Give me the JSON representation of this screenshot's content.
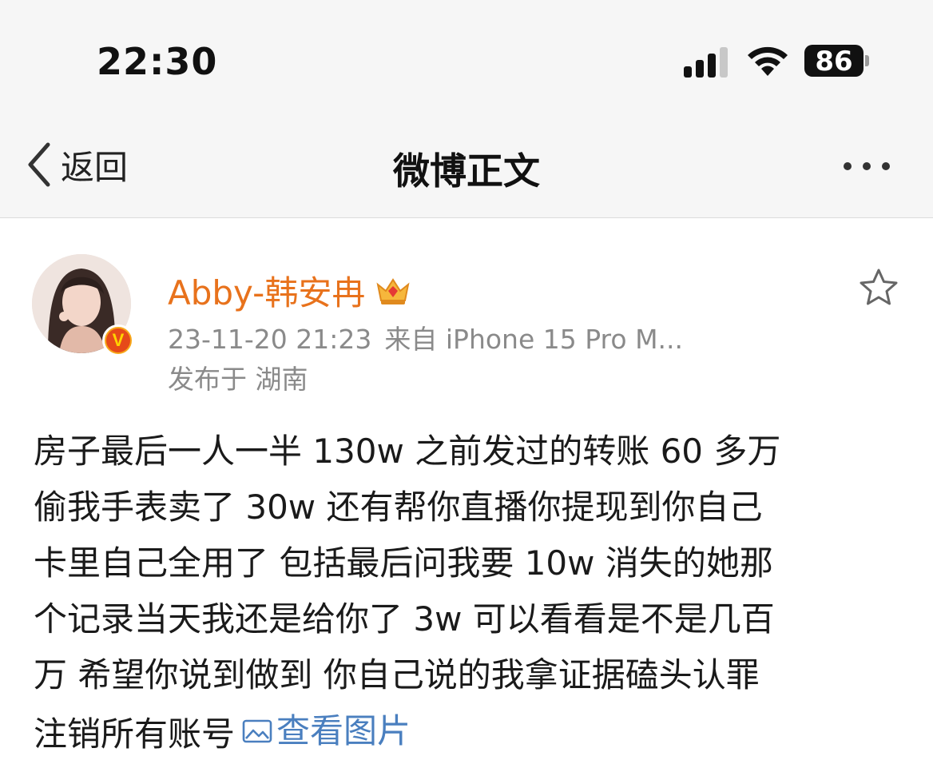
{
  "status_bar": {
    "time": "22:30",
    "battery": "86",
    "icons": [
      "cellular-signal-icon",
      "wifi-icon",
      "battery-icon"
    ]
  },
  "nav": {
    "back_label": "返回",
    "title": "微博正文",
    "icons": [
      "chevron-left-icon",
      "more-icon"
    ]
  },
  "post": {
    "author": "Abby-韩安冉",
    "verified": true,
    "meta_time": "23-11-20 21:23",
    "meta_source": "来自 iPhone 15 Pro M...",
    "location": "发布于 湖南",
    "body_lines": [
      "房子最后一人一半 130w 之前发过的转账 60 多万",
      "偷我手表卖了 30w 还有帮你直播你提现到你自己",
      "卡里自己全用了 包括最后问我要 10w 消失的她那",
      "个记录当天我还是给你了 3w 可以看看是不是几百",
      "万 希望你说到做到 你自己说的我拿证据磕头认罪"
    ],
    "body_last_line": "注销所有账号",
    "view_images_label": "查看图片",
    "colors": {
      "author": "#e8721c",
      "link": "#4a7fbf",
      "meta": "#8a8a8a"
    }
  }
}
